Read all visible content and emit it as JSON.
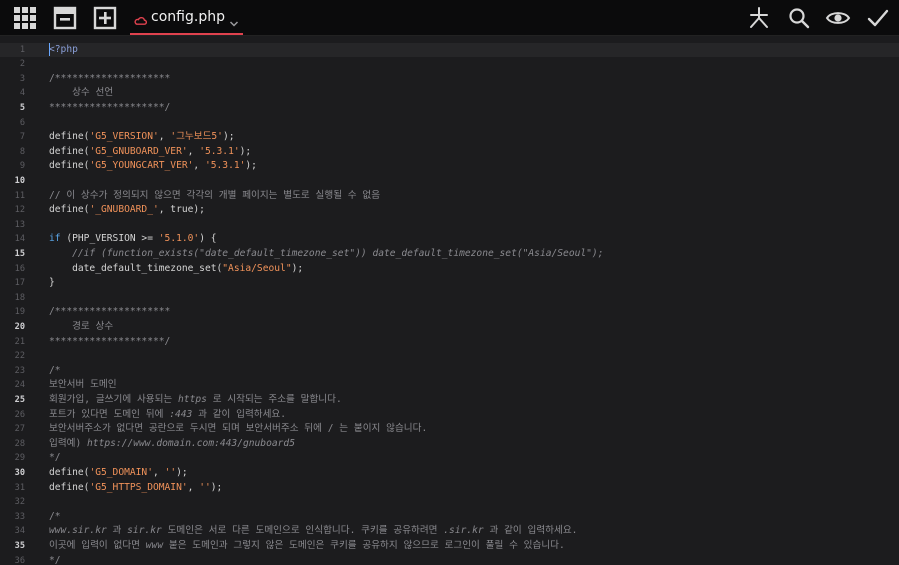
{
  "toolbar": {
    "left_icons": [
      "grid-icon",
      "collapse-icon",
      "add-icon"
    ],
    "right_icons": [
      "sparkle-icon",
      "search-icon",
      "preview-eye-icon",
      "checkmark-icon"
    ],
    "accent_color": "#e0424e"
  },
  "tab": {
    "title": "config.php",
    "icon": "cloud-icon"
  },
  "editor": {
    "bold_line_numbers": [
      5,
      10,
      15,
      20,
      25,
      30,
      35
    ],
    "active_line": 1,
    "lines": [
      [
        {
          "t": "<?php",
          "c": "tag"
        }
      ],
      [],
      [
        {
          "t": "/********************",
          "c": "cmt"
        }
      ],
      [
        {
          "t": "    상수 선언",
          "c": "cmt"
        }
      ],
      [
        {
          "t": "********************/",
          "c": "cmt"
        }
      ],
      [],
      [
        {
          "t": "define(",
          "c": "plain"
        },
        {
          "t": "'G5_VERSION'",
          "c": "str"
        },
        {
          "t": ", ",
          "c": "plain"
        },
        {
          "t": "'그누보드5'",
          "c": "str"
        },
        {
          "t": ");",
          "c": "plain"
        }
      ],
      [
        {
          "t": "define(",
          "c": "plain"
        },
        {
          "t": "'G5_GNUBOARD_VER'",
          "c": "str"
        },
        {
          "t": ", ",
          "c": "plain"
        },
        {
          "t": "'5.3.1'",
          "c": "str"
        },
        {
          "t": ");",
          "c": "plain"
        }
      ],
      [
        {
          "t": "define(",
          "c": "plain"
        },
        {
          "t": "'G5_YOUNGCART_VER'",
          "c": "str"
        },
        {
          "t": ", ",
          "c": "plain"
        },
        {
          "t": "'5.3.1'",
          "c": "str"
        },
        {
          "t": ");",
          "c": "plain"
        }
      ],
      [],
      [
        {
          "t": "// 이 상수가 정의되지 않으면 각각의 개별 페이지는 별도로 실행될 수 없음",
          "c": "cmt"
        }
      ],
      [
        {
          "t": "define(",
          "c": "plain"
        },
        {
          "t": "'_GNUBOARD_'",
          "c": "str"
        },
        {
          "t": ", true);",
          "c": "plain"
        }
      ],
      [],
      [
        {
          "t": "if",
          "c": "kw"
        },
        {
          "t": " (PHP_VERSION >= ",
          "c": "plain"
        },
        {
          "t": "'5.1.0'",
          "c": "str"
        },
        {
          "t": ") {",
          "c": "plain"
        }
      ],
      [
        {
          "t": "    //if (function_exists(\"date_default_timezone_set\")) date_default_timezone_set(\"Asia/Seoul\");",
          "c": "cmt",
          "i": true
        }
      ],
      [
        {
          "t": "    date_default_timezone_set(",
          "c": "plain"
        },
        {
          "t": "\"Asia/Seoul\"",
          "c": "str"
        },
        {
          "t": ");",
          "c": "plain"
        }
      ],
      [
        {
          "t": "}",
          "c": "plain"
        }
      ],
      [],
      [
        {
          "t": "/********************",
          "c": "cmt"
        }
      ],
      [
        {
          "t": "    경로 상수",
          "c": "cmt"
        }
      ],
      [
        {
          "t": "********************/",
          "c": "cmt"
        }
      ],
      [],
      [
        {
          "t": "/*",
          "c": "cmt"
        }
      ],
      [
        {
          "t": "보안서버 도메인",
          "c": "cmt"
        }
      ],
      [
        {
          "t": "회원가입, 글쓰기에 사용되는 ",
          "c": "cmt"
        },
        {
          "t": "https",
          "c": "cmt",
          "i": true
        },
        {
          "t": " 로 시작되는 주소를 말합니다.",
          "c": "cmt"
        }
      ],
      [
        {
          "t": "포트가 있다면 도메인 뒤에 ",
          "c": "cmt"
        },
        {
          "t": ":443",
          "c": "cmt",
          "i": true
        },
        {
          "t": " 과 같이 입력하세요.",
          "c": "cmt"
        }
      ],
      [
        {
          "t": "보안서버주소가 없다면 공란으로 두시면 되며 보안서버주소 뒤에 / 는 붙이지 않습니다.",
          "c": "cmt"
        }
      ],
      [
        {
          "t": "입력예) ",
          "c": "cmt"
        },
        {
          "t": "https://www.domain.com:443/gnuboard5",
          "c": "cmt",
          "i": true
        }
      ],
      [
        {
          "t": "*/",
          "c": "cmt"
        }
      ],
      [
        {
          "t": "define(",
          "c": "plain"
        },
        {
          "t": "'G5_DOMAIN'",
          "c": "str"
        },
        {
          "t": ", ",
          "c": "plain"
        },
        {
          "t": "''",
          "c": "str"
        },
        {
          "t": ");",
          "c": "plain"
        }
      ],
      [
        {
          "t": "define(",
          "c": "plain"
        },
        {
          "t": "'G5_HTTPS_DOMAIN'",
          "c": "str"
        },
        {
          "t": ", ",
          "c": "plain"
        },
        {
          "t": "''",
          "c": "str"
        },
        {
          "t": ");",
          "c": "plain"
        }
      ],
      [],
      [
        {
          "t": "/*",
          "c": "cmt"
        }
      ],
      [
        {
          "t": "www.sir.kr",
          "c": "cmt",
          "i": true
        },
        {
          "t": " 과 ",
          "c": "cmt"
        },
        {
          "t": "sir.kr",
          "c": "cmt",
          "i": true
        },
        {
          "t": " 도메인은 서로 다른 도메인으로 인식합니다. 쿠키를 공유하려면 ",
          "c": "cmt"
        },
        {
          "t": ".sir.kr",
          "c": "cmt",
          "i": true
        },
        {
          "t": " 과 같이 입력하세요.",
          "c": "cmt"
        }
      ],
      [
        {
          "t": "이곳에 입력이 없다면 ",
          "c": "cmt"
        },
        {
          "t": "www",
          "c": "cmt",
          "i": true
        },
        {
          "t": " 붙은 도메인과 그렇지 않은 도메인은 쿠키를 공유하지 않으므로 로그인이 풀릴 수 있습니다.",
          "c": "cmt"
        }
      ],
      [
        {
          "t": "*/",
          "c": "cmt"
        }
      ]
    ]
  }
}
